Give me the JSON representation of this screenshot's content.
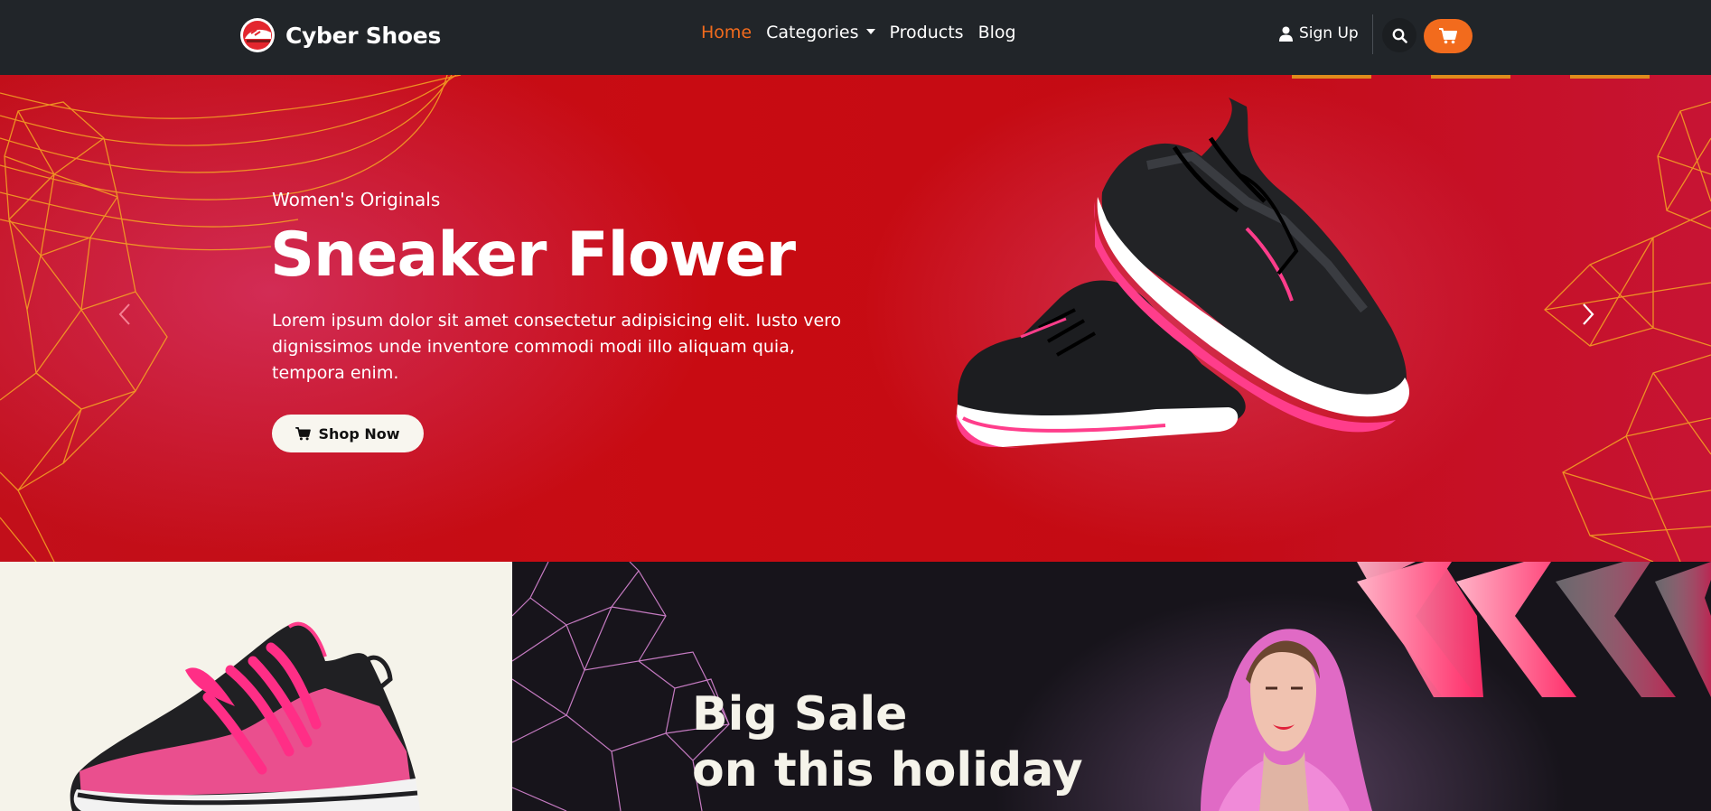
{
  "brand": {
    "name": "Cyber Shoes"
  },
  "nav": {
    "links": [
      {
        "label": "Home",
        "active": true
      },
      {
        "label": "Categories",
        "dropdown": true
      },
      {
        "label": "Products"
      },
      {
        "label": "Blog"
      }
    ],
    "signup_label": "Sign Up"
  },
  "hero": {
    "subtitle": "Women's Originals",
    "title": "Sneaker Flower",
    "text": "Lorem ipsum dolor sit amet consectetur adipisicing elit. Iusto vero dignissimos unde inventore commodi modi illo aliquam quia, tempora enim.",
    "button_label": "Shop Now"
  },
  "promo": {
    "title_line1": "Big Sale",
    "title_line2": "on this holiday"
  },
  "colors": {
    "accent": "#f26b1d",
    "navbar_bg": "#212529",
    "hero_red": "#c80b12",
    "hero_lines": "#f5a623",
    "promo_dark": "#17141b",
    "cream": "#f5f3ea",
    "pink": "#ff3d8b"
  },
  "icons": [
    "brand-logo-icon",
    "user-icon",
    "search-icon",
    "cart-icon",
    "chevron-left-icon",
    "chevron-right-icon",
    "chevron-down-icon"
  ]
}
